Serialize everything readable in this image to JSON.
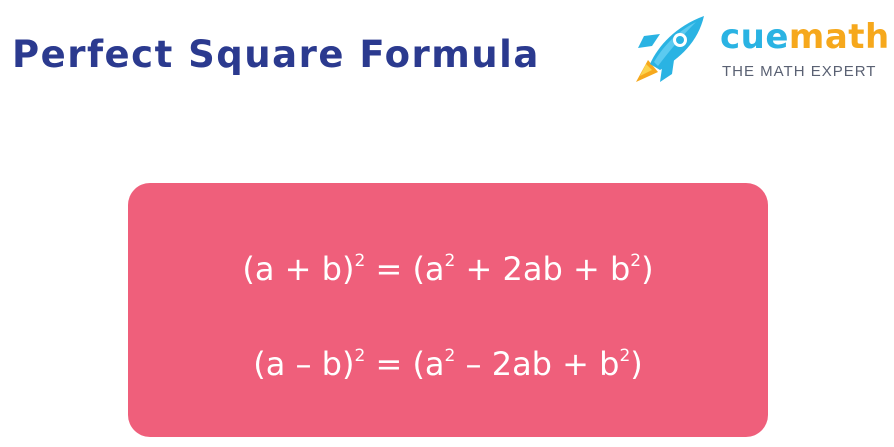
{
  "header": {
    "title": "Perfect Square Formula"
  },
  "logo": {
    "brand_part1": "cue",
    "brand_part2": "math",
    "tagline": "THE MATH EXPERT",
    "icon": "rocket-icon"
  },
  "formulas": [
    {
      "lhs_base": "(a + b)",
      "lhs_exp": "2",
      "rhs_open": "= (a",
      "rhs_exp1": "2",
      "rhs_mid": "+ 2ab + b",
      "rhs_exp2": "2",
      "rhs_close": ")"
    },
    {
      "lhs_base": "(a – b)",
      "lhs_exp": "2",
      "rhs_open": "= (a",
      "rhs_exp1": "2",
      "rhs_mid": "– 2ab + b",
      "rhs_exp2": "2",
      "rhs_close": ")"
    }
  ],
  "colors": {
    "title": "#2b3a8f",
    "card_background": "#ef5f7b",
    "formula_text": "#ffffff",
    "brand_cue": "#2ab3e3",
    "brand_math": "#f6a81c"
  }
}
